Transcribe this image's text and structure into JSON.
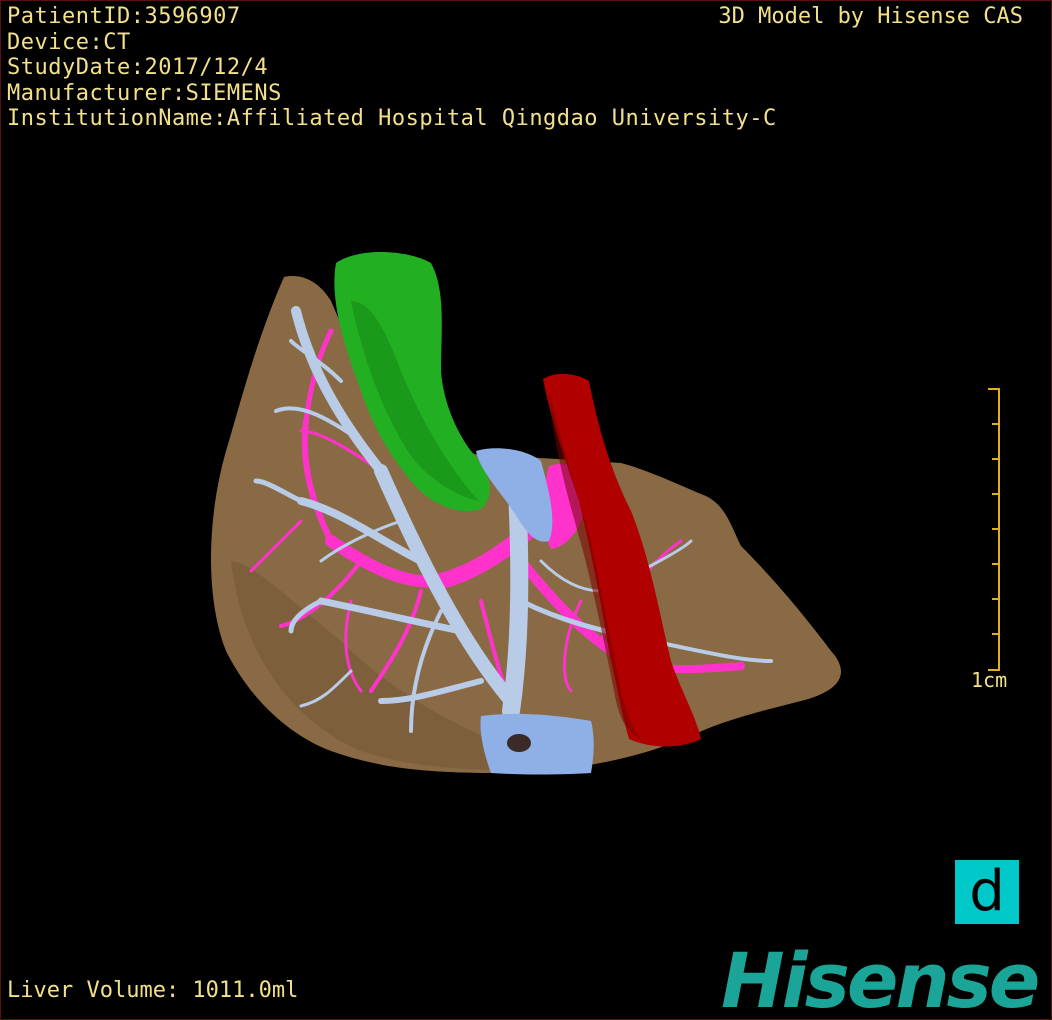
{
  "study": {
    "patient_id": "PatientID:3596907",
    "device": "Device:CT",
    "study_date": "StudyDate:2017/12/4",
    "manufacturer": "Manufacturer:SIEMENS",
    "institution": "InstitutionName:Affiliated Hospital Qingdao University-C"
  },
  "brand_caption": "3D Model by Hisense CAS",
  "volume_text": "Liver Volume: 1011.0ml",
  "scale": {
    "label": "1cm",
    "ticks": 9
  },
  "view_badge": "d",
  "logo_text": "Hisense",
  "colors": {
    "text": "#f2e08a",
    "liver": "#8a6a44",
    "gallbladder": "#1fa81f",
    "ivc": "#b00000",
    "portal_vein": "#ff33cc",
    "hepatic_vein": "#b8cce8",
    "badge": "#00c8c8",
    "logo": "#1aa598"
  },
  "icons": [
    "scale-bar-icon",
    "view-badge-icon"
  ]
}
